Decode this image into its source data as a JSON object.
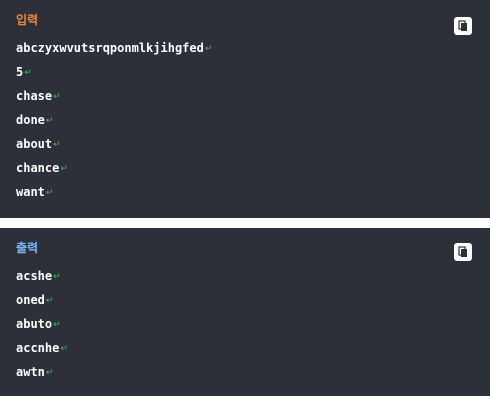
{
  "input": {
    "label": "입력",
    "lines": [
      "abczyxwvutsrqponmlkjihgfed",
      "5",
      "chase",
      "done",
      "about",
      "chance",
      "want"
    ]
  },
  "output": {
    "label": "출력",
    "lines": [
      "acshe",
      "oned",
      "abuto",
      "accnhe",
      "awtn"
    ]
  },
  "icons": {
    "copy": "copy-icon",
    "line_end": "return-icon"
  },
  "colors": {
    "panel_bg": "#2d3039",
    "input_label": "#f0883e",
    "output_label": "#79b8ff",
    "line_end_mark": "#3fb950"
  }
}
